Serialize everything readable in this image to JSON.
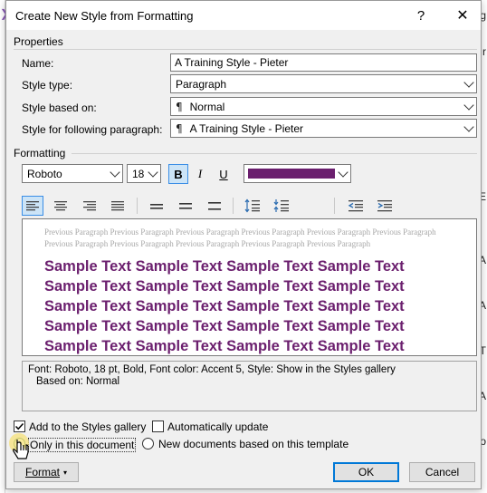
{
  "dialog": {
    "title": "Create New Style from Formatting",
    "help": "?",
    "close": "✕"
  },
  "properties": {
    "group": "Properties",
    "name_label": "Name:",
    "name_value": "A Training Style - Pieter",
    "type_label": "Style type:",
    "type_value": "Paragraph",
    "based_label": "Style based on:",
    "based_value": "Normal",
    "following_label": "Style for following paragraph:",
    "following_value": "A Training Style - Pieter"
  },
  "formatting": {
    "group": "Formatting",
    "font": "Roboto",
    "size": "18",
    "bold": "B",
    "italic": "I",
    "underline": "U",
    "font_color": "#6b1f6e"
  },
  "preview": {
    "previous_paragraph": "Previous Paragraph Previous Paragraph Previous Paragraph Previous Paragraph Previous Paragraph Previous Paragraph Previous Paragraph Previous Paragraph Previous Paragraph Previous Paragraph Previous Paragraph",
    "sample_lines": [
      "Sample Text Sample Text Sample Text Sample Text",
      "Sample Text Sample Text Sample Text Sample Text",
      "Sample Text Sample Text Sample Text Sample Text",
      "Sample Text Sample Text Sample Text Sample Text",
      "Sample Text Sample Text Sample Text Sample Text"
    ]
  },
  "description": {
    "line1": "Font: Roboto, 18 pt, Bold, Font color: Accent 5, Style: Show in the Styles gallery",
    "line2": "Based on: Normal"
  },
  "options": {
    "add_gallery": "Add to the Styles gallery",
    "auto_update": "Automatically update",
    "only_doc": "Only in this document",
    "new_docs": "New documents based on this template"
  },
  "buttons": {
    "format": "Format",
    "ok": "OK",
    "cancel": "Cancel"
  },
  "background": {
    "right_chars": [
      "g",
      "r",
      "E",
      "A",
      "A",
      "T",
      "A",
      "o"
    ]
  }
}
